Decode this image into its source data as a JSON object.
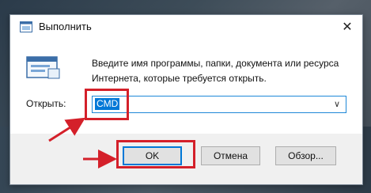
{
  "window": {
    "title": "Выполнить",
    "close_label": "✕"
  },
  "description": {
    "line1": "Введите имя программы, папки, документа или ресурса",
    "line2": "Интернета, которые требуется открыть."
  },
  "open_field": {
    "label": "Открыть:",
    "value": "CMD"
  },
  "buttons": {
    "ok": "OK",
    "cancel": "Отмена",
    "browse": "Обзор..."
  },
  "colors": {
    "highlight": "#d4202a",
    "selection": "#0078d7"
  }
}
